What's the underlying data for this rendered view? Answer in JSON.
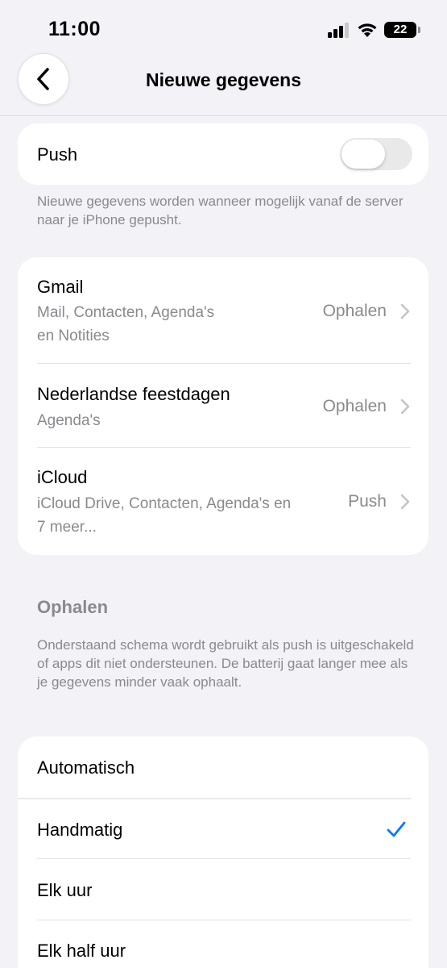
{
  "status_bar": {
    "time": "11:00",
    "battery_level": "22",
    "icons": [
      "signal-icon",
      "wifi-icon",
      "battery-icon"
    ]
  },
  "nav": {
    "back_icon": "chevron-left-icon",
    "title": "Nieuwe gegevens"
  },
  "push": {
    "label": "Push",
    "enabled": false,
    "footnote": "Nieuwe gegevens worden wanneer mogelijk vanaf de server naar je iPhone gepusht."
  },
  "accounts": [
    {
      "name": "Gmail",
      "sub_line1": "Mail, Contacten, Agenda's",
      "sub_line2": "en Notities",
      "value": "Ophalen"
    },
    {
      "name": "Nederlandse feestdagen",
      "sub_line1": "Agenda's",
      "value": "Ophalen"
    },
    {
      "name": "iCloud",
      "sub_line1": "iCloud Drive, Contacten, Agenda's en",
      "sub_line2": "7 meer...",
      "value": "Push"
    }
  ],
  "fetch": {
    "header": "Ophalen",
    "footnote": "Onderstaand schema wordt gebruikt als push is uitgeschakeld of apps dit niet ondersteunen. De batterij gaat langer mee als je gegevens minder vaak ophaalt.",
    "options": [
      "Automatisch",
      "Handmatig",
      "Elk uur",
      "Elk half uur"
    ],
    "selected": "Handmatig"
  },
  "colors": {
    "accent": "#007aff",
    "background": "#f2f2f7",
    "secondary_text": "#8a8a8e"
  }
}
